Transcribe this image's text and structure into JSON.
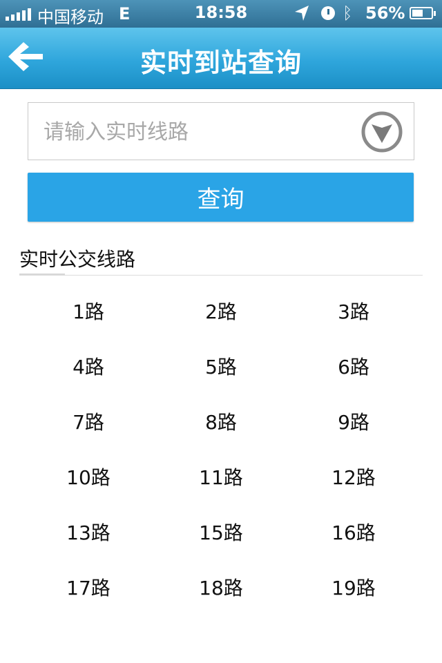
{
  "status_bar": {
    "carrier": "中国移动",
    "network": "E",
    "time": "18:58",
    "battery_percent": "56%",
    "battery_level": 0.56,
    "icons": [
      "signal-icon",
      "location-icon",
      "alarm-clock-icon",
      "bluetooth-icon",
      "battery-icon"
    ]
  },
  "nav": {
    "title": "实时到站查询",
    "back_icon": "back-arrow-icon"
  },
  "search": {
    "placeholder": "请输入实时线路",
    "value": "",
    "dropdown_icon": "chevron-down-circle-icon"
  },
  "query_button": {
    "label": "查询"
  },
  "section": {
    "title": "实时公交线路"
  },
  "routes": [
    "1路",
    "2路",
    "3路",
    "4路",
    "5路",
    "6路",
    "7路",
    "8路",
    "9路",
    "10路",
    "11路",
    "12路",
    "13路",
    "15路",
    "16路",
    "17路",
    "18路",
    "19路",
    "",
    "",
    ""
  ],
  "colors": {
    "nav_bar": "#2fa6dc",
    "query_button": "#2aa4e6",
    "status_bar": "#3d82a8"
  }
}
